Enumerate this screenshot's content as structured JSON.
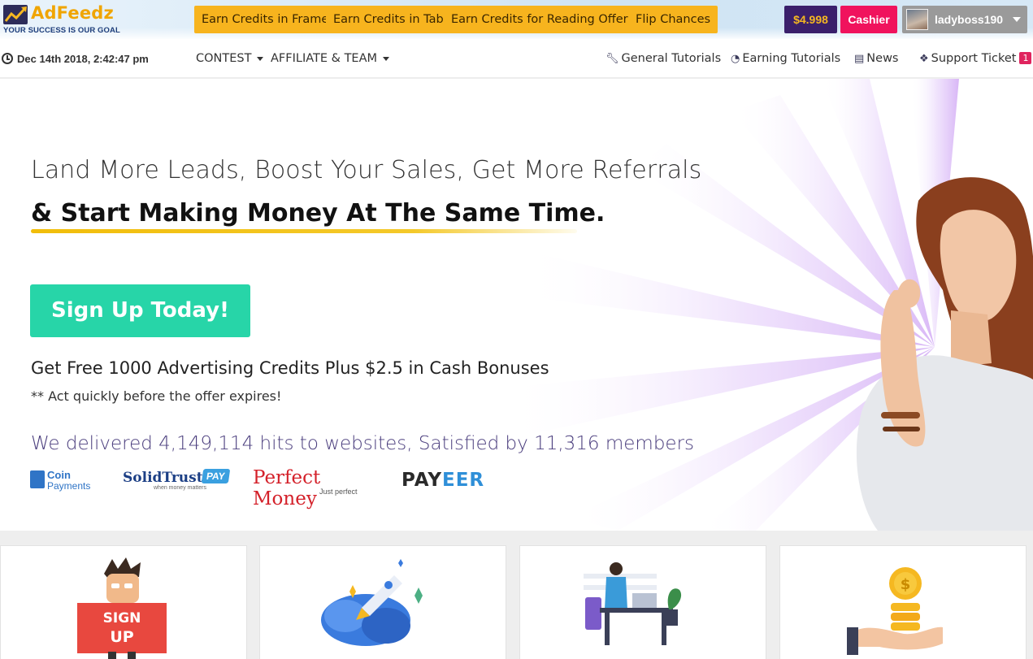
{
  "header": {
    "logo": {
      "name": "AdFeedz",
      "tagline": "YOUR SUCCESS IS OUR GOAL",
      "icon": "chart-arrow-logo-icon"
    },
    "earn_buttons": [
      {
        "label": "Earn Credits in Frame"
      },
      {
        "label": "Earn Credits in Tab"
      },
      {
        "label": "Earn Credits for Reading Offers"
      },
      {
        "label": "Flip Chances"
      }
    ],
    "balance": "$4.998",
    "cashier_label": "Cashier",
    "username": "ladyboss190"
  },
  "subnav": {
    "datetime": "Dec 14th 2018, 2:42:47 pm",
    "dropdowns": [
      "CONTEST",
      "AFFILIATE & TEAM"
    ],
    "links": [
      {
        "label": "General Tutorials",
        "icon": "wrench-icon"
      },
      {
        "label": "Earning Tutorials",
        "icon": "pie-chart-icon"
      },
      {
        "label": "News",
        "icon": "newspaper-icon"
      },
      {
        "label": "Support Ticket",
        "icon": "ticket-icon",
        "badge": "1"
      }
    ]
  },
  "hero": {
    "headline_line1": "Land More Leads, Boost Your Sales, Get More Referrals",
    "headline_line2": "& Start Making Money At The Same Time.",
    "cta_label": "Sign Up Today!",
    "offer": "Get Free 1000 Advertising Credits Plus $2.5 in Cash Bonuses",
    "offer_note": "** Act quickly before the offer expires!",
    "stats": "We delivered 4,149,114 hits to websites, Satisfied by 11,316 members",
    "payment_logos": {
      "coinpayments": {
        "line1": "Coin",
        "line2": "Payments"
      },
      "solidtrust": {
        "name": "SolidTrust",
        "pay": "PAY",
        "sub": "when money matters"
      },
      "perfectmoney": {
        "name": "Perfect Money",
        "sub": "Just perfect"
      },
      "payeer": {
        "pre": "PAY",
        "post": "EER"
      }
    }
  },
  "cards": [
    {
      "icon": "sign-up-character-icon"
    },
    {
      "icon": "rocket-cloud-icon"
    },
    {
      "icon": "person-at-desk-icon"
    },
    {
      "icon": "hand-holding-coins-icon"
    }
  ],
  "colors": {
    "earn_button": "#f7b41e",
    "balance_bg": "#3a1f6b",
    "cashier_bg": "#f0135d",
    "cta": "#27d5a8",
    "stats_text": "#4a3d7d"
  }
}
